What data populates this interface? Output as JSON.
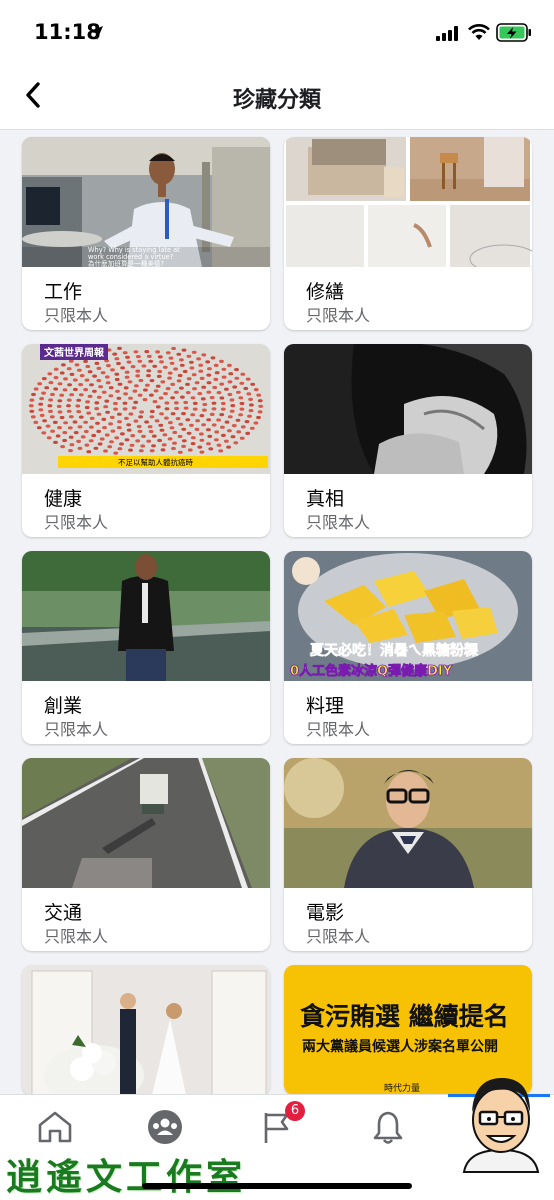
{
  "status": {
    "time": "11:18"
  },
  "header": {
    "title": "珍藏分類"
  },
  "collections": [
    {
      "title": "工作",
      "privacy": "只限本人"
    },
    {
      "title": "修繕",
      "privacy": "只限本人"
    },
    {
      "title": "健康",
      "privacy": "只限本人"
    },
    {
      "title": "真相",
      "privacy": "只限本人"
    },
    {
      "title": "創業",
      "privacy": "只限本人"
    },
    {
      "title": "料理",
      "privacy": "只限本人"
    },
    {
      "title": "交通",
      "privacy": "只限本人"
    },
    {
      "title": "電影",
      "privacy": "只限本人"
    }
  ],
  "thumb_text": {
    "work_caption_1": "Why? Why is staying late at",
    "work_caption_2": "work considered a virtue?",
    "work_caption_3": "為什麼加班算是一種美德?",
    "health_channel": "文茜世界周報",
    "health_caption": "不足以幫助人體抗癌時",
    "food_banner_1": "夏天必吃！消暑ㄟ黑糖粉粿",
    "food_banner_2": "0人工色素冰涼Q彈健康DIY",
    "news_headline": "貪污賄選 繼續提名",
    "news_sub": "兩大黨議員候選人涉案名單公開",
    "news_logo": "時代力量"
  },
  "nav": {
    "home_icon": "home-icon",
    "groups_icon": "groups-icon",
    "pages_icon": "flag-icon",
    "pages_badge": "6",
    "notifications_icon": "bell-icon",
    "profile_icon": "avatar"
  },
  "watermark": "逍遙文工作室",
  "colors": {
    "accent": "#1877f2",
    "badge": "#e41e3f",
    "news_bg": "#f7c203",
    "watermark": "#1a7a1f"
  }
}
